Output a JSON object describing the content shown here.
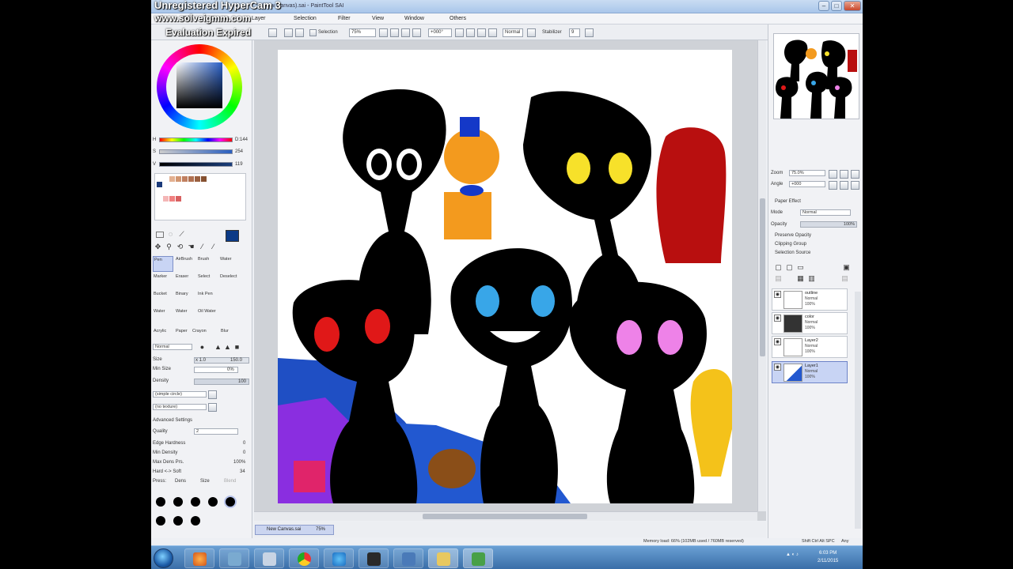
{
  "watermark": {
    "line1": "Unregistered HyperCam 3",
    "line2": "www.solveigmm.com",
    "line3": "Evaluation Expired"
  },
  "window": {
    "title": "(New Canvas).sai - PaintTool SAI",
    "min": "–",
    "max": "□",
    "close": "✕"
  },
  "menu": [
    "File",
    "Edit",
    "Canvas",
    "Layer",
    "Selection",
    "Filter",
    "View",
    "Window",
    "Others"
  ],
  "toolbar": {
    "selection_label": "Selection",
    "zoom": "75%",
    "angle": "+000°",
    "mode": "Normal",
    "stabilizer_label": "Stabilizer",
    "stabilizer_value": "9"
  },
  "color_sliders": [
    {
      "label": "H",
      "value": "D:144",
      "color": "#e03020"
    },
    {
      "label": "S",
      "value": "254",
      "color": "#2a5fc0"
    },
    {
      "label": "V",
      "value": "119",
      "color": "#1a3e7c"
    }
  ],
  "tools": {
    "labels": [
      "Pen",
      "AirBrush",
      "Brush",
      "Water",
      "Marker",
      "Eraser",
      "Select",
      "Deselect",
      "Bucket",
      "Binary",
      "Ink Pen",
      "",
      "Water",
      "Water",
      "Oil Water",
      "",
      "Acrylic",
      "Paper",
      "Crayon",
      "Blur"
    ]
  },
  "brush": {
    "mode": "Normal",
    "size_label": "Size",
    "size_mult": "x 1.0",
    "size_value": "150.0",
    "min_size_label": "Min Size",
    "min_size_value": "0%",
    "density_label": "Density",
    "density_value": "100",
    "shape": "(simple circle)",
    "texture": "(no texture)",
    "advanced_label": "Advanced Settings",
    "quality_label": "Quality",
    "quality_value": "2",
    "edge_label": "Edge Hardness",
    "edge_value": "0",
    "mindens_label": "Min Density",
    "mindens_value": "0",
    "maxdens_label": "Max Dens Prs.",
    "maxdens_value": "100%",
    "hardsoft_label": "Hard <-> Soft",
    "hardsoft_value": "34",
    "press_label": "Press:",
    "press_dens": "Dens",
    "press_size": "Size",
    "press_blend": "Blend"
  },
  "navigator": {
    "zoom_label": "Zoom",
    "zoom_value": "75.0%",
    "angle_label": "Angle",
    "angle_value": "+000"
  },
  "layer_props": {
    "paper_effect": "Paper Effect",
    "mode_label": "Mode",
    "mode_value": "Normal",
    "opacity_label": "Opacity",
    "opacity_value": "100%",
    "opts": [
      "Preserve Opacity",
      "Clipping Group",
      "Selection Source"
    ]
  },
  "layers": [
    {
      "name": "outline",
      "mode": "Normal",
      "opacity": "100%",
      "selected": false
    },
    {
      "name": "color",
      "mode": "Normal",
      "opacity": "100%",
      "selected": false
    },
    {
      "name": "Layer2",
      "mode": "Normal",
      "opacity": "100%",
      "selected": false
    },
    {
      "name": "Layer1",
      "mode": "Normal",
      "opacity": "100%",
      "selected": true
    }
  ],
  "document_tab": {
    "name": "New Canvas.sai",
    "zoom": "75%"
  },
  "status": {
    "memory": "Memory load: 66% (102MB used / 760MB reserved)",
    "keys": "Shift Ctrl Alt SPC",
    "any": "Any"
  },
  "clock": {
    "time": "6:03 PM",
    "date": "2/11/2015"
  }
}
